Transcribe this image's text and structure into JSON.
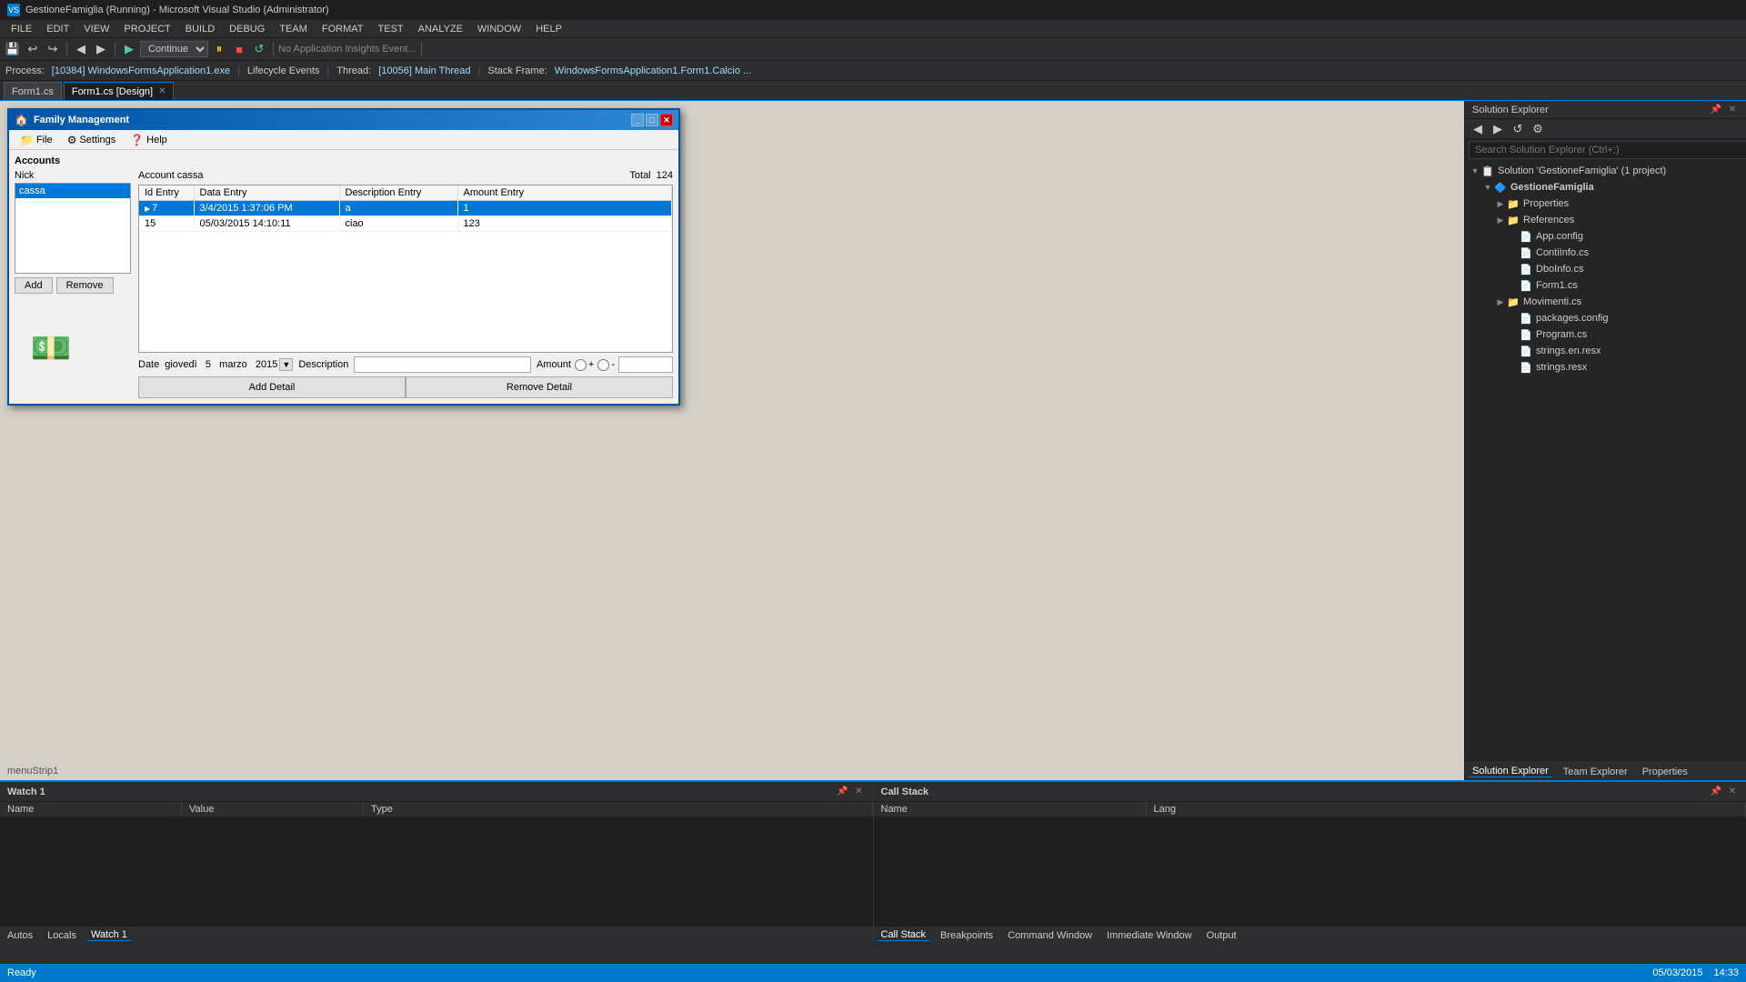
{
  "titlebar": {
    "title": "GestioneFamiglia (Running) - Microsoft Visual Studio (Administrator)",
    "icon": "VS"
  },
  "menubar": {
    "items": [
      "FILE",
      "EDIT",
      "VIEW",
      "PROJECT",
      "BUILD",
      "DEBUG",
      "TEAM",
      "FORMAT",
      "TEST",
      "ANALYZE",
      "WINDOW",
      "HELP"
    ]
  },
  "processbar": {
    "process_label": "Process:",
    "process_value": "[10384] WindowsFormsApplication1.exe",
    "lifecycle_label": "Lifecycle Events",
    "thread_label": "Thread:",
    "thread_value": "[10056] Main Thread",
    "stackframe_label": "Stack Frame:",
    "stackframe_value": "WindowsFormsApplication1.Form1.Calcio ..."
  },
  "tabbar": {
    "tabs": [
      {
        "label": "Form1.cs",
        "active": false,
        "closeable": false
      },
      {
        "label": "Form1.cs [Design]",
        "active": true,
        "closeable": true
      }
    ]
  },
  "form": {
    "title": "Family Management",
    "menu": [
      {
        "icon": "📁",
        "label": "File"
      },
      {
        "icon": "⚙",
        "label": "Settings"
      },
      {
        "icon": "❓",
        "label": "Help"
      }
    ],
    "accounts_label": "Accounts",
    "nick_label": "Nick",
    "listbox_items": [
      {
        "text": "cassa",
        "selected": true
      }
    ],
    "add_btn": "Add",
    "remove_btn": "Remove",
    "account_cassa_label": "Account  cassa",
    "total_label": "Total",
    "total_value": "124",
    "table": {
      "columns": [
        "Id Entry",
        "Data Entry",
        "Description Entry",
        "Amount Entry"
      ],
      "rows": [
        {
          "id": "7",
          "date": "3/4/2015 1:37:06 PM",
          "description": "a",
          "amount": "1",
          "selected": true,
          "arrow": true
        },
        {
          "id": "15",
          "date": "05/03/2015 14:10:11",
          "description": "ciao",
          "amount": "123",
          "selected": false,
          "arrow": false
        }
      ]
    },
    "date_label": "Date",
    "date_value": "giovedì  5  marzo  2015",
    "description_label": "Description",
    "amount_label": "Amount",
    "add_detail_btn": "Add Detail",
    "remove_detail_btn": "Remove Detail"
  },
  "solution_explorer": {
    "title": "Solution Explorer",
    "search_placeholder": "Search Solution Explorer (Ctrl+;)",
    "tree": [
      {
        "level": 0,
        "expanded": true,
        "icon": "📋",
        "label": "Solution 'GestioneFamiglia' (1 project)"
      },
      {
        "level": 1,
        "expanded": true,
        "icon": "🔷",
        "label": "GestioneFamiglia",
        "bold": true
      },
      {
        "level": 2,
        "expanded": false,
        "icon": "📁",
        "label": "Properties"
      },
      {
        "level": 2,
        "expanded": false,
        "icon": "📁",
        "label": "References"
      },
      {
        "level": 3,
        "expanded": false,
        "icon": "📄",
        "label": "App.config"
      },
      {
        "level": 3,
        "expanded": false,
        "icon": "📄",
        "label": "ContiInfo.cs"
      },
      {
        "level": 3,
        "expanded": false,
        "icon": "📄",
        "label": "DboInfo.cs"
      },
      {
        "level": 3,
        "expanded": false,
        "icon": "📄",
        "label": "Form1.cs"
      },
      {
        "level": 2,
        "expanded": false,
        "icon": "📁",
        "label": "Movimenti.cs"
      },
      {
        "level": 3,
        "expanded": false,
        "icon": "📄",
        "label": "packages.config"
      },
      {
        "level": 3,
        "expanded": false,
        "icon": "📄",
        "label": "Program.cs"
      },
      {
        "level": 3,
        "expanded": false,
        "icon": "📄",
        "label": "strings.en.resx"
      },
      {
        "level": 3,
        "expanded": false,
        "icon": "📄",
        "label": "strings.resx"
      }
    ]
  },
  "watch_panel": {
    "title": "Watch 1",
    "columns": {
      "name": "Name",
      "value": "Value",
      "type": "Type"
    }
  },
  "callstack_panel": {
    "title": "Call Stack",
    "columns": {
      "name": "Name",
      "lang": "Lang"
    }
  },
  "bottom_tabs": {
    "watch_tabs": [
      "Autos",
      "Locals",
      "Watch 1"
    ],
    "active_watch": "Watch 1",
    "stack_tabs": [
      "Call Stack",
      "Breakpoints",
      "Command Window",
      "Immediate Window",
      "Output"
    ],
    "active_stack": "Call Stack"
  },
  "panel_bottom_tabs": {
    "items": [
      "Solution Explorer",
      "Team Explorer",
      "Properties"
    ],
    "active": "Solution Explorer"
  },
  "statusbar": {
    "status": "Ready",
    "time": "14:33",
    "date": "05/03/2015"
  },
  "menustrip": {
    "label": "menuStrip1"
  }
}
